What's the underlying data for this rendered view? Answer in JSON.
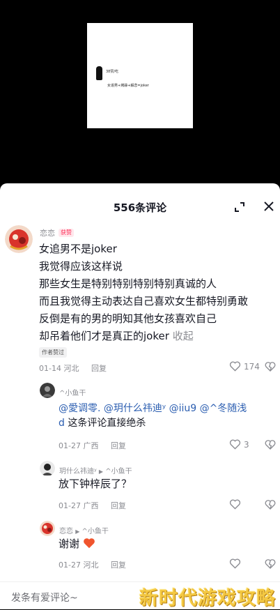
{
  "video": {
    "line1": "38赞/吃",
    "line2": "女追男+烤蒜+解恋=joker"
  },
  "sheet": {
    "title": "556条评论"
  },
  "main_comment": {
    "username": "恋恋",
    "badge": "获赞",
    "lines": [
      "女追男不是joker",
      "我觉得应该这样说",
      "那些女生是特别特别特别特别真诚的人",
      "而且我觉得主动表达自己喜欢女生都特别勇敢",
      "反倒是有的男的明知其他女孩喜欢自己",
      "却吊着他们才是真正的joker"
    ],
    "collapse_label": "收起",
    "author_liked": "作者赞过",
    "date": "01-14",
    "location": "河北",
    "reply_label": "回复",
    "likes": "174"
  },
  "replies": [
    {
      "username": "^小鱼干",
      "mentions": "@愛调零. @玥什么祎迪ʸ @iiu9 @^冬随浅",
      "mentions_line2": "d",
      "text": "这条评论直接绝杀",
      "date": "01-27",
      "location": "广西",
      "reply_label": "回复",
      "likes": "3"
    },
    {
      "username": "玥什么祎迪ʸ",
      "reply_to": "^小鱼干",
      "text": "放下钟梓辰了？",
      "date": "01-27",
      "location": "广西",
      "reply_label": "回复"
    },
    {
      "username": "恋恋",
      "reply_to": "^小鱼干",
      "text": "谢谢",
      "date": "01-27",
      "location": "河北",
      "reply_label": "回复"
    }
  ],
  "input": {
    "placeholder": "发条有爱评论~"
  },
  "watermark": "新时代游戏攻略",
  "colors": {
    "accent": "#fe2c55",
    "mention": "#2a5db0",
    "watermark": "#f4c842"
  }
}
